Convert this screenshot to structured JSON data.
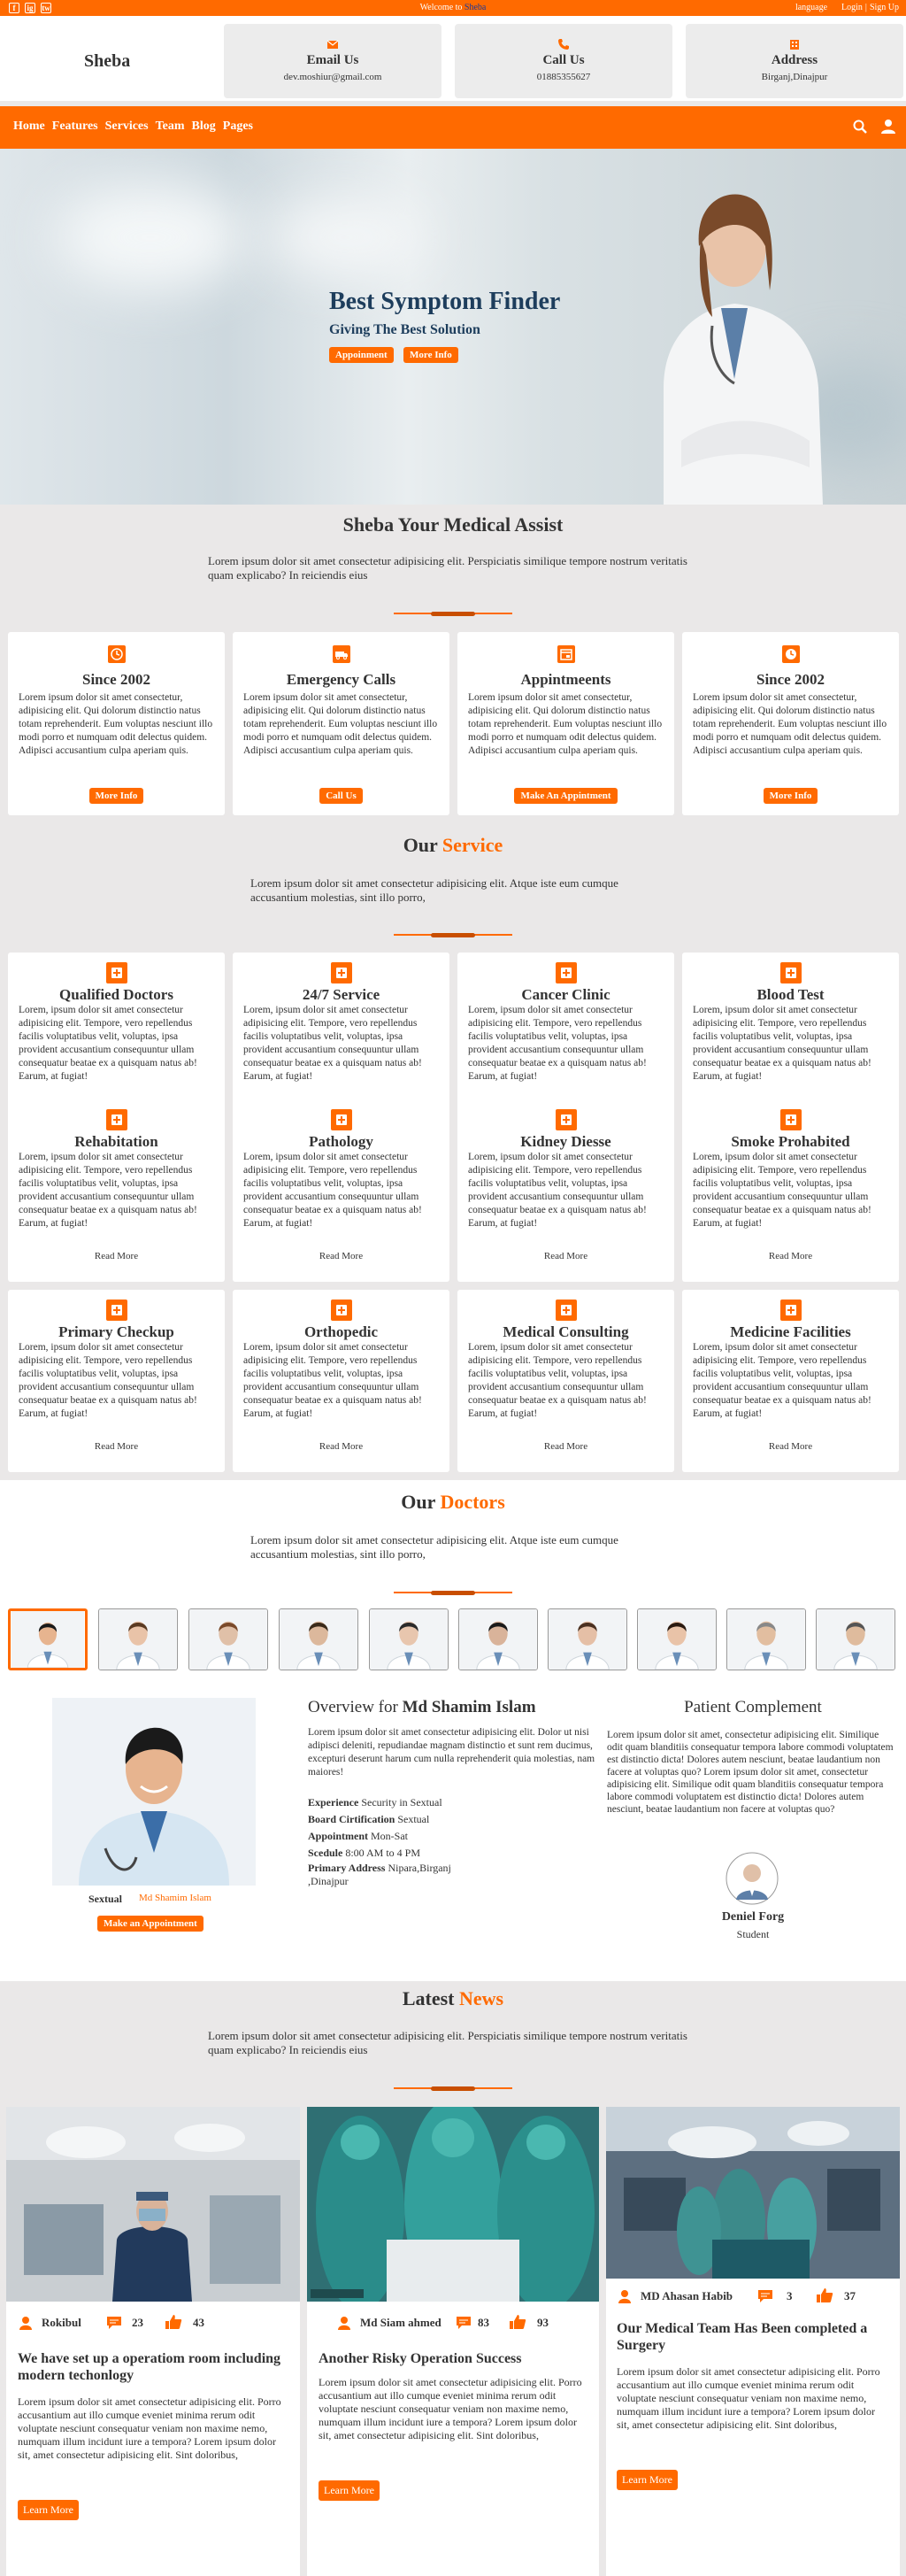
{
  "topbar": {
    "social": [
      "f",
      "ig",
      "tw"
    ],
    "welcome_prefix": "Welcome to ",
    "welcome_brand": "Sheba",
    "links": [
      "language",
      "Login",
      "|",
      "Sign Up"
    ]
  },
  "header": {
    "brand": "Sheba",
    "boxes": [
      {
        "icon": "envelope-icon",
        "title": "Email Us",
        "value": "dev.moshiur@gmail.com"
      },
      {
        "icon": "phone-icon",
        "title": "Call Us",
        "value": "01885355627"
      },
      {
        "icon": "building-icon",
        "title": "Address",
        "value": "Birganj,Dinajpur"
      }
    ]
  },
  "nav": {
    "links": [
      "Home",
      "Features",
      "Services",
      "Team",
      "Blog",
      "Pages"
    ]
  },
  "hero": {
    "title": "Best Symptom Finder",
    "subtitle": "Giving The Best Solution",
    "btn1": "Appoinment",
    "btn2": "More Info"
  },
  "assist": {
    "heading": "Sheba Your Medical Assist",
    "text": "Lorem ipsum dolor sit amet consectetur adipisicing elit. Perspiciatis similique tempore nostrum veritatis quam explicabo? In reiciendis eius",
    "cards": [
      {
        "title": "Since 2002",
        "text": "Lorem ipsum dolor sit amet consectetur, adipisicing elit. Qui dolorum distinctio natus totam reprehenderit. Eum voluptas nesciunt illo modi porro et numquam odit delectus quidem. Adipisci accusantium culpa aperiam quis.",
        "button": "More Info"
      },
      {
        "title": "Emergency Calls",
        "text": "Lorem ipsum dolor sit amet consectetur, adipisicing elit. Qui dolorum distinctio natus totam reprehenderit. Eum voluptas nesciunt illo modi porro et numquam odit delectus quidem. Adipisci accusantium culpa aperiam quis.",
        "button": "Call Us"
      },
      {
        "title": "Appintmeents",
        "text": "Lorem ipsum dolor sit amet consectetur, adipisicing elit. Qui dolorum distinctio natus totam reprehenderit. Eum voluptas nesciunt illo modi porro et numquam odit delectus quidem. Adipisci accusantium culpa aperiam quis.",
        "button": "Make An Appintment"
      },
      {
        "title": "Since 2002",
        "text": "Lorem ipsum dolor sit amet consectetur, adipisicing elit. Qui dolorum distinctio natus totam reprehenderit. Eum voluptas nesciunt illo modi porro et numquam odit delectus quidem. Adipisci accusantium culpa aperiam quis.",
        "button": "More Info"
      }
    ]
  },
  "service": {
    "heading_a": "Our ",
    "heading_b": "Service",
    "text": "Lorem ipsum dolor sit amet consectetur adipisicing elit. Atque iste eum cumque accusantium molestias, sint illo porro,",
    "item_text": "Lorem, ipsum dolor sit amet consectetur adipisicing elit. Tempore, vero repellendus facilis voluptatibus velit, voluptas, ipsa provident accusantium consequuntur ullam consequatur beatae ex a quisquam natus ab! Earum, at fugiat!",
    "read_more": "Read More",
    "items": [
      "Qualified Doctors",
      "24/7 Service",
      "Cancer Clinic",
      "Blood Test",
      "Rehabitation",
      "Pathology",
      "Kidney Diesse",
      "Smoke Prohabited",
      "Primary Checkup",
      "Orthopedic",
      "Medical Consulting",
      "Medicine Facilities"
    ]
  },
  "doctors": {
    "heading_a": "Our ",
    "heading_b": "Doctors",
    "text": "Lorem ipsum dolor sit amet consectetur adipisicing elit. Atque iste eum cumque accusantium molestias, sint illo porro,",
    "profile": {
      "specialty": "Sextual",
      "name": "Md Shamim Islam",
      "button": "Make an Appointment",
      "overview_prefix": "Overview for ",
      "overview_text": "Lorem ipsum dolor sit amet consectetur adipisicing elit. Dolor ut nisi adipisci deleniti, repudiandae magnam distinctio et sunt rem ducimus, excepturi deserunt harum cum nulla reprehenderit quia molestias, nam maiores!",
      "fields": [
        {
          "label": "Experience",
          "value": "Security in Sextual"
        },
        {
          "label": "Board Cirtification",
          "value": "Sextual"
        },
        {
          "label": "Appointment",
          "value": "Mon-Sat"
        },
        {
          "label": "Scedule",
          "value": "8:00 AM to 4 PM"
        },
        {
          "label": "Primary Address",
          "value": "Nipara,Birganj ,Dinajpur"
        }
      ]
    },
    "complement": {
      "heading": "Patient Complement",
      "text": "Lorem ipsum dolor sit amet, consectetur adipisicing elit. Similique odit quam blanditiis consequatur tempora labore commodi voluptatem est distinctio dicta! Dolores autem nesciunt, beatae laudantium non facere at voluptas quo? Lorem ipsum dolor sit amet, consectetur adipisicing elit. Similique odit quam blanditiis consequatur tempora labore commodi voluptatem est distinctio dicta! Dolores autem nesciunt, beatae laudantium non facere at voluptas quo?",
      "name": "Deniel Forg",
      "role": "Student"
    }
  },
  "news": {
    "heading_a": "Latest ",
    "heading_b": "News",
    "text": "Lorem ipsum dolor sit amet consectetur adipisicing elit. Perspiciatis similique tempore nostrum veritatis quam explicabo? In reiciendis eius",
    "articles": [
      {
        "author": "Rokibul",
        "comments": "23",
        "likes": "43",
        "title": "We have set up a operatiom room including modern techonlogy",
        "text": "Lorem ipsum dolor sit amet consectetur adipisicing elit. Porro accusantium aut illo cumque eveniet minima rerum odit voluptate nesciunt consequatur veniam non maxime nemo, numquam illum incidunt iure a tempora? Lorem ipsum dolor sit, amet consectetur adipisicing elit. Sint doloribus,",
        "button": "Learn More"
      },
      {
        "author": "Md Siam ahmed",
        "comments": "83",
        "likes": "93",
        "title": "Another Risky Operation Success",
        "text": "Lorem ipsum dolor sit amet consectetur adipisicing elit. Porro accusantium aut illo cumque eveniet minima rerum odit voluptate nesciunt consequatur veniam non maxime nemo, numquam illum incidunt iure a tempora? Lorem ipsum dolor sit, amet consectetur adipisicing elit. Sint doloribus,",
        "button": "Learn More"
      },
      {
        "author": "MD Ahasan Habib",
        "comments": "3",
        "likes": "37",
        "title": "Our Medical Team Has Been completed a Surgery",
        "text": "Lorem ipsum dolor sit amet consectetur adipisicing elit. Porro accusantium aut illo cumque eveniet minima rerum odit voluptate nesciunt consequatur veniam non maxime nemo, numquam illum incidunt iure a tempora? Lorem ipsum dolor sit, amet consectetur adipisicing elit. Sint doloribus,",
        "button": "Learn More"
      }
    ]
  },
  "colors": {
    "accent": "#ff6a00",
    "page_bg": "#eae8e8",
    "hero_title": "#1d3d5c"
  }
}
